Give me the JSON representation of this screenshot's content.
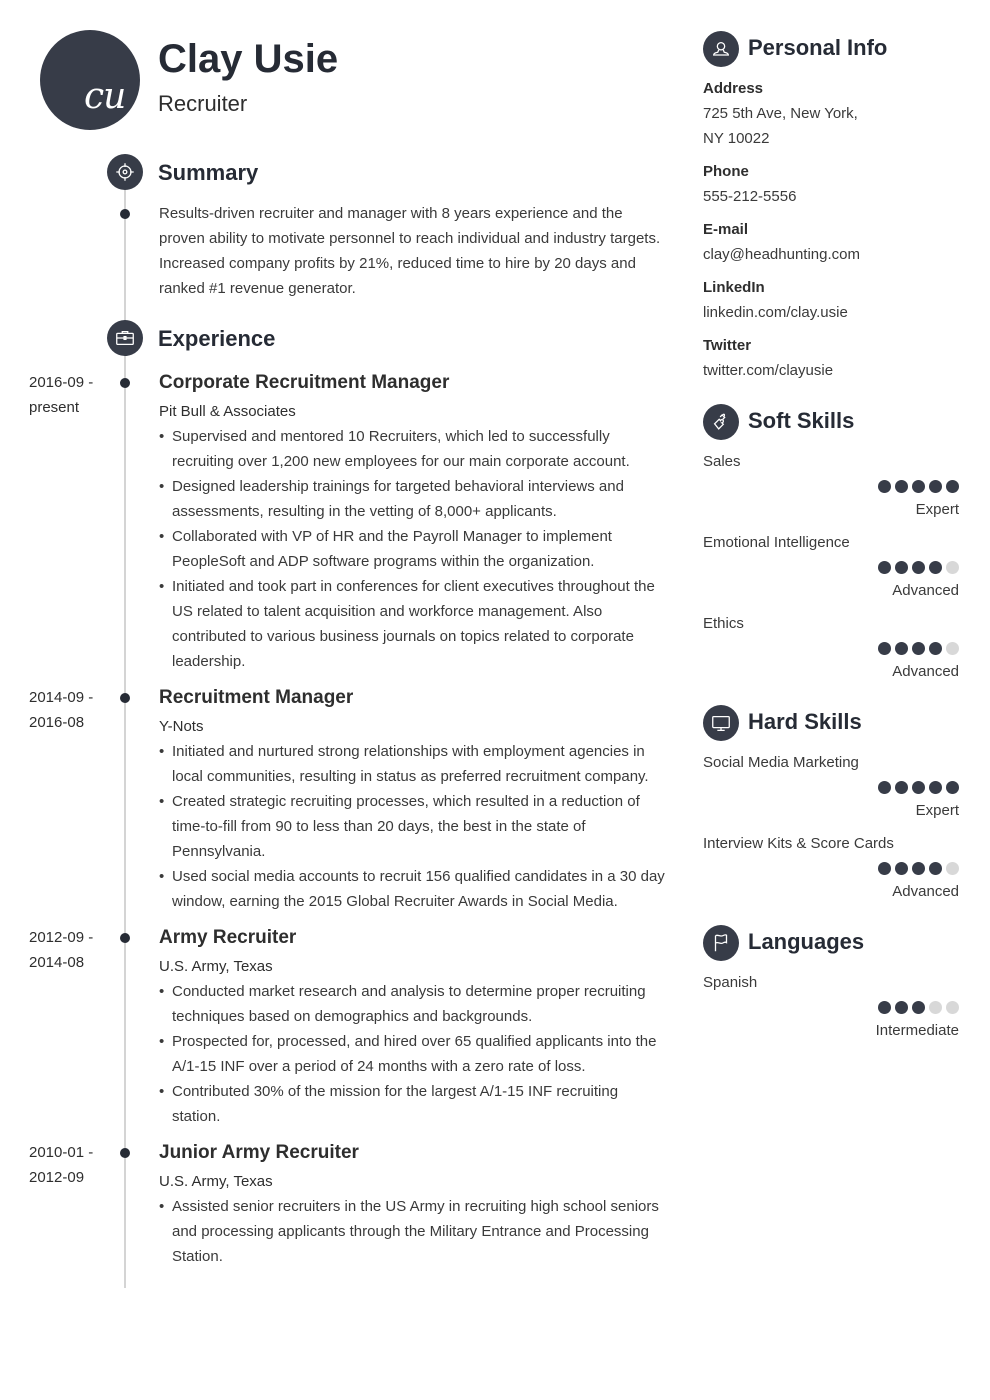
{
  "header": {
    "initials": "cu",
    "name": "Clay Usie",
    "title": "Recruiter"
  },
  "sections": {
    "summary": {
      "title": "Summary",
      "icon": "target-icon"
    },
    "experience": {
      "title": "Experience",
      "icon": "briefcase-icon"
    },
    "personal_info": {
      "title": "Personal Info",
      "icon": "user-icon"
    },
    "soft_skills": {
      "title": "Soft Skills",
      "icon": "puzzle-icon"
    },
    "hard_skills": {
      "title": "Hard Skills",
      "icon": "monitor-icon"
    },
    "languages": {
      "title": "Languages",
      "icon": "flag-icon"
    }
  },
  "summary": {
    "text": "Results-driven recruiter and manager with 8 years experience and the proven ability to motivate personnel to reach individual and industry targets. Increased company profits by 21%, reduced time to hire by 20 days and ranked #1 revenue generator."
  },
  "experience": [
    {
      "date_start": "2016-09 -",
      "date_end": "present",
      "title": "Corporate Recruitment Manager",
      "company": "Pit Bull & Associates",
      "bullets": [
        "Supervised and mentored 10 Recruiters, which led to successfully recruiting over 1,200 new employees for our main corporate account.",
        "Designed leadership trainings for targeted behavioral interviews and assessments, resulting in the vetting of 8,000+ applicants.",
        "Collaborated with VP of HR and the Payroll Manager to implement PeopleSoft and ADP software programs within the organization.",
        "Initiated and took part in conferences for client executives throughout the US related to talent acquisition and workforce management. Also contributed to various business journals on topics related to corporate leadership."
      ]
    },
    {
      "date_start": "2014-09 -",
      "date_end": "2016-08",
      "title": "Recruitment Manager",
      "company": "Y-Nots",
      "bullets": [
        "Initiated and nurtured strong relationships with employment agencies in local communities, resulting in status as preferred recruitment company.",
        "Created strategic recruiting processes, which resulted in a reduction of time-to-fill from 90 to less than 20 days, the best in the state of Pennsylvania.",
        "Used social media accounts to recruit 156 qualified candidates in a 30 day window, earning the 2015 Global Recruiter Awards in Social Media."
      ]
    },
    {
      "date_start": "2012-09 -",
      "date_end": "2014-08",
      "title": "Army Recruiter",
      "company": "U.S. Army, Texas",
      "bullets": [
        "Conducted market research and analysis to determine proper recruiting techniques based on demographics and backgrounds.",
        "Prospected for, processed, and hired over 65 qualified applicants into the A/1-15 INF over a period of 24 months with a zero rate of loss.",
        "Contributed 30% of the mission for the largest A/1-15 INF recruiting station."
      ]
    },
    {
      "date_start": "2010-01 -",
      "date_end": "2012-09",
      "title": "Junior Army Recruiter",
      "company": "U.S. Army, Texas",
      "bullets": [
        "Assisted senior recruiters in the US Army in recruiting high school seniors and processing applicants through the Military Entrance and Processing Station."
      ]
    }
  ],
  "personal_info": [
    {
      "label": "Address",
      "value": "725 5th Ave, New York, NY 10022"
    },
    {
      "label": "Phone",
      "value": "555-212-5556"
    },
    {
      "label": "E-mail",
      "value": "clay@headhunting.com"
    },
    {
      "label": "LinkedIn",
      "value": "linkedin.com/clay.usie"
    },
    {
      "label": "Twitter",
      "value": "twitter.com/clayusie"
    }
  ],
  "soft_skills": [
    {
      "name": "Sales",
      "rating": 5,
      "max": 5,
      "level": "Expert"
    },
    {
      "name": "Emotional Intelligence",
      "rating": 4,
      "max": 5,
      "level": "Advanced"
    },
    {
      "name": "Ethics",
      "rating": 4,
      "max": 5,
      "level": "Advanced"
    }
  ],
  "hard_skills": [
    {
      "name": "Social Media Marketing",
      "rating": 5,
      "max": 5,
      "level": "Expert"
    },
    {
      "name": "Interview Kits & Score Cards",
      "rating": 4,
      "max": 5,
      "level": "Advanced"
    }
  ],
  "languages": [
    {
      "name": "Spanish",
      "rating": 3,
      "max": 5,
      "level": "Intermediate"
    }
  ],
  "colors": {
    "accent": "#373c48",
    "heading": "#262b35",
    "text": "#3a3a3a",
    "rating_empty": "#d8d8d8",
    "timeline": "#d4d4d4"
  }
}
